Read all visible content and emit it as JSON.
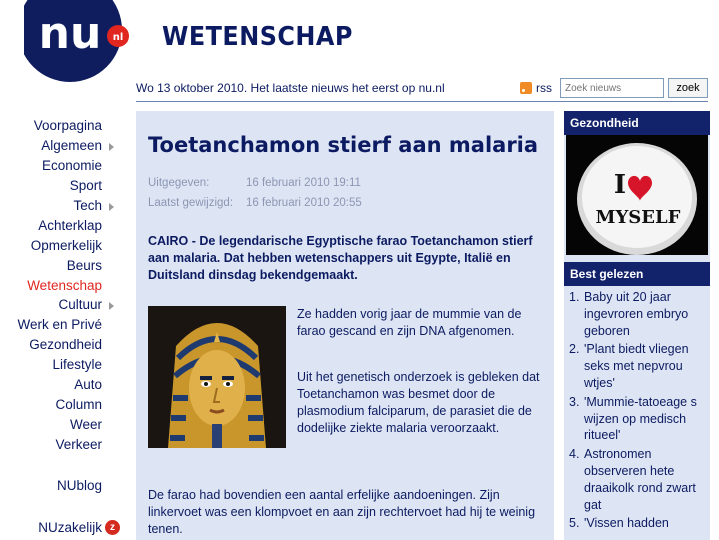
{
  "header": {
    "logo_text": "nu",
    "logo_badge": "nl",
    "section_title": "WETENSCHAP",
    "date_line": "Wo 13 oktober 2010. Het laatste nieuws het eerst op nu.nl",
    "rss_label": "rss",
    "search_placeholder": "Zoek nieuws",
    "search_button": "zoek"
  },
  "nav": {
    "items": [
      {
        "label": "Voorpagina",
        "arrow": false,
        "active": false
      },
      {
        "label": "Algemeen",
        "arrow": true,
        "active": false
      },
      {
        "label": "Economie",
        "arrow": false,
        "active": false
      },
      {
        "label": "Sport",
        "arrow": false,
        "active": false
      },
      {
        "label": "Tech",
        "arrow": true,
        "active": false
      },
      {
        "label": "Achterklap",
        "arrow": false,
        "active": false
      },
      {
        "label": "Opmerkelijk",
        "arrow": false,
        "active": false
      },
      {
        "label": "Beurs",
        "arrow": false,
        "active": false
      },
      {
        "label": "Wetenschap",
        "arrow": false,
        "active": true
      },
      {
        "label": "Cultuur",
        "arrow": true,
        "active": false
      },
      {
        "label": "Werk en Privé",
        "arrow": false,
        "active": false
      },
      {
        "label": "Gezondheid",
        "arrow": false,
        "active": false
      },
      {
        "label": "Lifestyle",
        "arrow": false,
        "active": false
      },
      {
        "label": "Auto",
        "arrow": false,
        "active": false
      },
      {
        "label": "Column",
        "arrow": false,
        "active": false
      },
      {
        "label": "Weer",
        "arrow": false,
        "active": false
      },
      {
        "label": "Verkeer",
        "arrow": false,
        "active": false
      }
    ],
    "nublog": "NUblog",
    "nuzakelijk": "NUzakelijk",
    "nuzakelijk_icon": "z"
  },
  "article": {
    "title": "Toetanchamon stierf aan malaria",
    "published_label": "Uitgegeven:",
    "published_value": "16 februari 2010 19:11",
    "updated_label": "Laatst gewijzigd:",
    "updated_value": "16 februari 2010 20:55",
    "lead": "CAIRO - De legendarische Egyptische farao Toetanchamon stierf aan malaria. Dat hebben wetenschappers uit Egypte, Italië en Duitsland dinsdag bekendgemaakt.",
    "para1": "Ze hadden vorig jaar de mummie van de farao gescand en zijn DNA afgenomen.",
    "para2": "Uit het genetisch onderzoek is gebleken dat Toetanchamon was besmet door de plasmodium falciparum, de parasiet die de dodelijke ziekte malaria veroorzaakt.",
    "para3": "De farao had bovendien een aantal erfelijke aandoeningen. Zijn linkervoet was een klompvoet en aan zijn rechtervoet had hij te weinig tenen."
  },
  "sidebar": {
    "health_title": "Gezondheid",
    "health_image_text_top": "I",
    "health_image_text_bottom": "MYSELF",
    "best_title": "Best gelezen",
    "best_items": [
      {
        "num": "1.",
        "text": "Baby uit 20 jaar ingevroren embryo geboren"
      },
      {
        "num": "2.",
        "text": "'Plant biedt vliegen seks met nepvrou wtjes'"
      },
      {
        "num": "3.",
        "text": "'Mummie-tatoeage s wijzen op medisch ritueel'"
      },
      {
        "num": "4.",
        "text": "Astronomen observeren hete draaikolk rond zwart gat"
      },
      {
        "num": "5.",
        "text": "'Vissen hadden"
      }
    ]
  },
  "colors": {
    "navy": "#0c1b61",
    "active_red": "#e0261f",
    "panel_bg": "#dde5f4",
    "head_bg": "#13236b"
  }
}
